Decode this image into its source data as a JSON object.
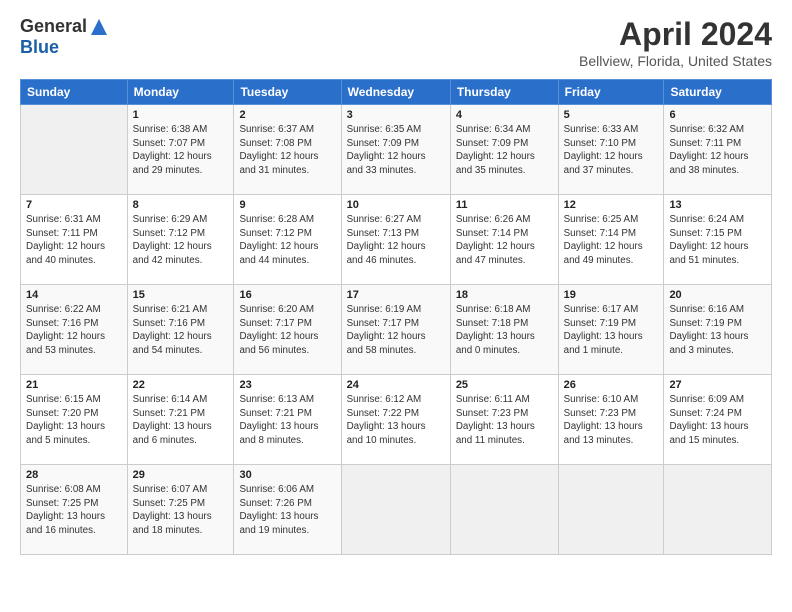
{
  "header": {
    "logo_general": "General",
    "logo_blue": "Blue",
    "title": "April 2024",
    "location": "Bellview, Florida, United States"
  },
  "weekdays": [
    "Sunday",
    "Monday",
    "Tuesday",
    "Wednesday",
    "Thursday",
    "Friday",
    "Saturday"
  ],
  "weeks": [
    [
      {
        "day": "",
        "info": ""
      },
      {
        "day": "1",
        "info": "Sunrise: 6:38 AM\nSunset: 7:07 PM\nDaylight: 12 hours\nand 29 minutes."
      },
      {
        "day": "2",
        "info": "Sunrise: 6:37 AM\nSunset: 7:08 PM\nDaylight: 12 hours\nand 31 minutes."
      },
      {
        "day": "3",
        "info": "Sunrise: 6:35 AM\nSunset: 7:09 PM\nDaylight: 12 hours\nand 33 minutes."
      },
      {
        "day": "4",
        "info": "Sunrise: 6:34 AM\nSunset: 7:09 PM\nDaylight: 12 hours\nand 35 minutes."
      },
      {
        "day": "5",
        "info": "Sunrise: 6:33 AM\nSunset: 7:10 PM\nDaylight: 12 hours\nand 37 minutes."
      },
      {
        "day": "6",
        "info": "Sunrise: 6:32 AM\nSunset: 7:11 PM\nDaylight: 12 hours\nand 38 minutes."
      }
    ],
    [
      {
        "day": "7",
        "info": "Sunrise: 6:31 AM\nSunset: 7:11 PM\nDaylight: 12 hours\nand 40 minutes."
      },
      {
        "day": "8",
        "info": "Sunrise: 6:29 AM\nSunset: 7:12 PM\nDaylight: 12 hours\nand 42 minutes."
      },
      {
        "day": "9",
        "info": "Sunrise: 6:28 AM\nSunset: 7:12 PM\nDaylight: 12 hours\nand 44 minutes."
      },
      {
        "day": "10",
        "info": "Sunrise: 6:27 AM\nSunset: 7:13 PM\nDaylight: 12 hours\nand 46 minutes."
      },
      {
        "day": "11",
        "info": "Sunrise: 6:26 AM\nSunset: 7:14 PM\nDaylight: 12 hours\nand 47 minutes."
      },
      {
        "day": "12",
        "info": "Sunrise: 6:25 AM\nSunset: 7:14 PM\nDaylight: 12 hours\nand 49 minutes."
      },
      {
        "day": "13",
        "info": "Sunrise: 6:24 AM\nSunset: 7:15 PM\nDaylight: 12 hours\nand 51 minutes."
      }
    ],
    [
      {
        "day": "14",
        "info": "Sunrise: 6:22 AM\nSunset: 7:16 PM\nDaylight: 12 hours\nand 53 minutes."
      },
      {
        "day": "15",
        "info": "Sunrise: 6:21 AM\nSunset: 7:16 PM\nDaylight: 12 hours\nand 54 minutes."
      },
      {
        "day": "16",
        "info": "Sunrise: 6:20 AM\nSunset: 7:17 PM\nDaylight: 12 hours\nand 56 minutes."
      },
      {
        "day": "17",
        "info": "Sunrise: 6:19 AM\nSunset: 7:17 PM\nDaylight: 12 hours\nand 58 minutes."
      },
      {
        "day": "18",
        "info": "Sunrise: 6:18 AM\nSunset: 7:18 PM\nDaylight: 13 hours\nand 0 minutes."
      },
      {
        "day": "19",
        "info": "Sunrise: 6:17 AM\nSunset: 7:19 PM\nDaylight: 13 hours\nand 1 minute."
      },
      {
        "day": "20",
        "info": "Sunrise: 6:16 AM\nSunset: 7:19 PM\nDaylight: 13 hours\nand 3 minutes."
      }
    ],
    [
      {
        "day": "21",
        "info": "Sunrise: 6:15 AM\nSunset: 7:20 PM\nDaylight: 13 hours\nand 5 minutes."
      },
      {
        "day": "22",
        "info": "Sunrise: 6:14 AM\nSunset: 7:21 PM\nDaylight: 13 hours\nand 6 minutes."
      },
      {
        "day": "23",
        "info": "Sunrise: 6:13 AM\nSunset: 7:21 PM\nDaylight: 13 hours\nand 8 minutes."
      },
      {
        "day": "24",
        "info": "Sunrise: 6:12 AM\nSunset: 7:22 PM\nDaylight: 13 hours\nand 10 minutes."
      },
      {
        "day": "25",
        "info": "Sunrise: 6:11 AM\nSunset: 7:23 PM\nDaylight: 13 hours\nand 11 minutes."
      },
      {
        "day": "26",
        "info": "Sunrise: 6:10 AM\nSunset: 7:23 PM\nDaylight: 13 hours\nand 13 minutes."
      },
      {
        "day": "27",
        "info": "Sunrise: 6:09 AM\nSunset: 7:24 PM\nDaylight: 13 hours\nand 15 minutes."
      }
    ],
    [
      {
        "day": "28",
        "info": "Sunrise: 6:08 AM\nSunset: 7:25 PM\nDaylight: 13 hours\nand 16 minutes."
      },
      {
        "day": "29",
        "info": "Sunrise: 6:07 AM\nSunset: 7:25 PM\nDaylight: 13 hours\nand 18 minutes."
      },
      {
        "day": "30",
        "info": "Sunrise: 6:06 AM\nSunset: 7:26 PM\nDaylight: 13 hours\nand 19 minutes."
      },
      {
        "day": "",
        "info": ""
      },
      {
        "day": "",
        "info": ""
      },
      {
        "day": "",
        "info": ""
      },
      {
        "day": "",
        "info": ""
      }
    ]
  ]
}
